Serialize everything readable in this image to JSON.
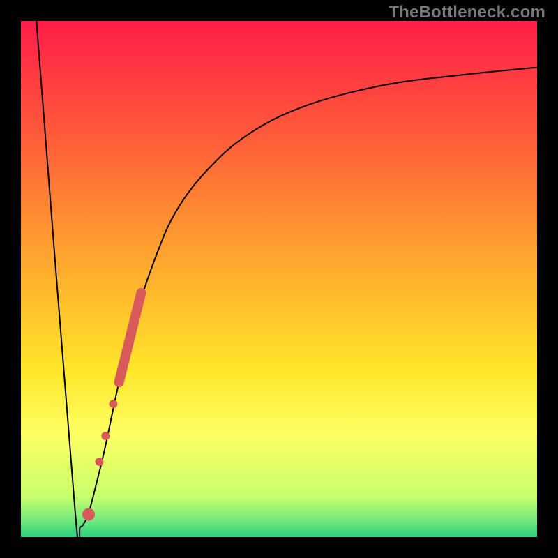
{
  "watermark": "TheBottleneck.com",
  "chart_data": {
    "type": "line",
    "title": "",
    "xlabel": "",
    "ylabel": "",
    "xlim": [
      0,
      100
    ],
    "ylim": [
      0,
      100
    ],
    "grid": false,
    "legend": false,
    "gradient_stops": [
      {
        "offset": 0,
        "color": "#ff1d48"
      },
      {
        "offset": 22,
        "color": "#ff5a3a"
      },
      {
        "offset": 45,
        "color": "#ffa32e"
      },
      {
        "offset": 68,
        "color": "#ffe72a"
      },
      {
        "offset": 80,
        "color": "#fdff63"
      },
      {
        "offset": 92,
        "color": "#c9ff6b"
      },
      {
        "offset": 97,
        "color": "#6fe77e"
      },
      {
        "offset": 100,
        "color": "#2ad37d"
      }
    ],
    "series": [
      {
        "name": "left-branch",
        "x": [
          3,
          10.5,
          11.5,
          13
        ],
        "y": [
          100,
          5,
          2,
          4
        ]
      },
      {
        "name": "right-branch",
        "x": [
          13,
          16,
          19,
          22,
          26,
          30,
          36,
          44,
          55,
          70,
          85,
          100
        ],
        "y": [
          4,
          16,
          30,
          42,
          54,
          63,
          71,
          78,
          83.5,
          87.5,
          89.5,
          91
        ]
      }
    ],
    "markers": {
      "name": "highlight-cluster",
      "color": "#d85a5a",
      "bar_segment": {
        "x1": 19,
        "y1": 30,
        "x2": 23.3,
        "y2": 47.3
      },
      "points": [
        {
          "x": 17.9,
          "y": 25.8,
          "r": 6
        },
        {
          "x": 16.4,
          "y": 19.6,
          "r": 6
        },
        {
          "x": 15.2,
          "y": 14.6,
          "r": 6
        },
        {
          "x": 13.1,
          "y": 4.4,
          "r": 9
        }
      ]
    }
  }
}
